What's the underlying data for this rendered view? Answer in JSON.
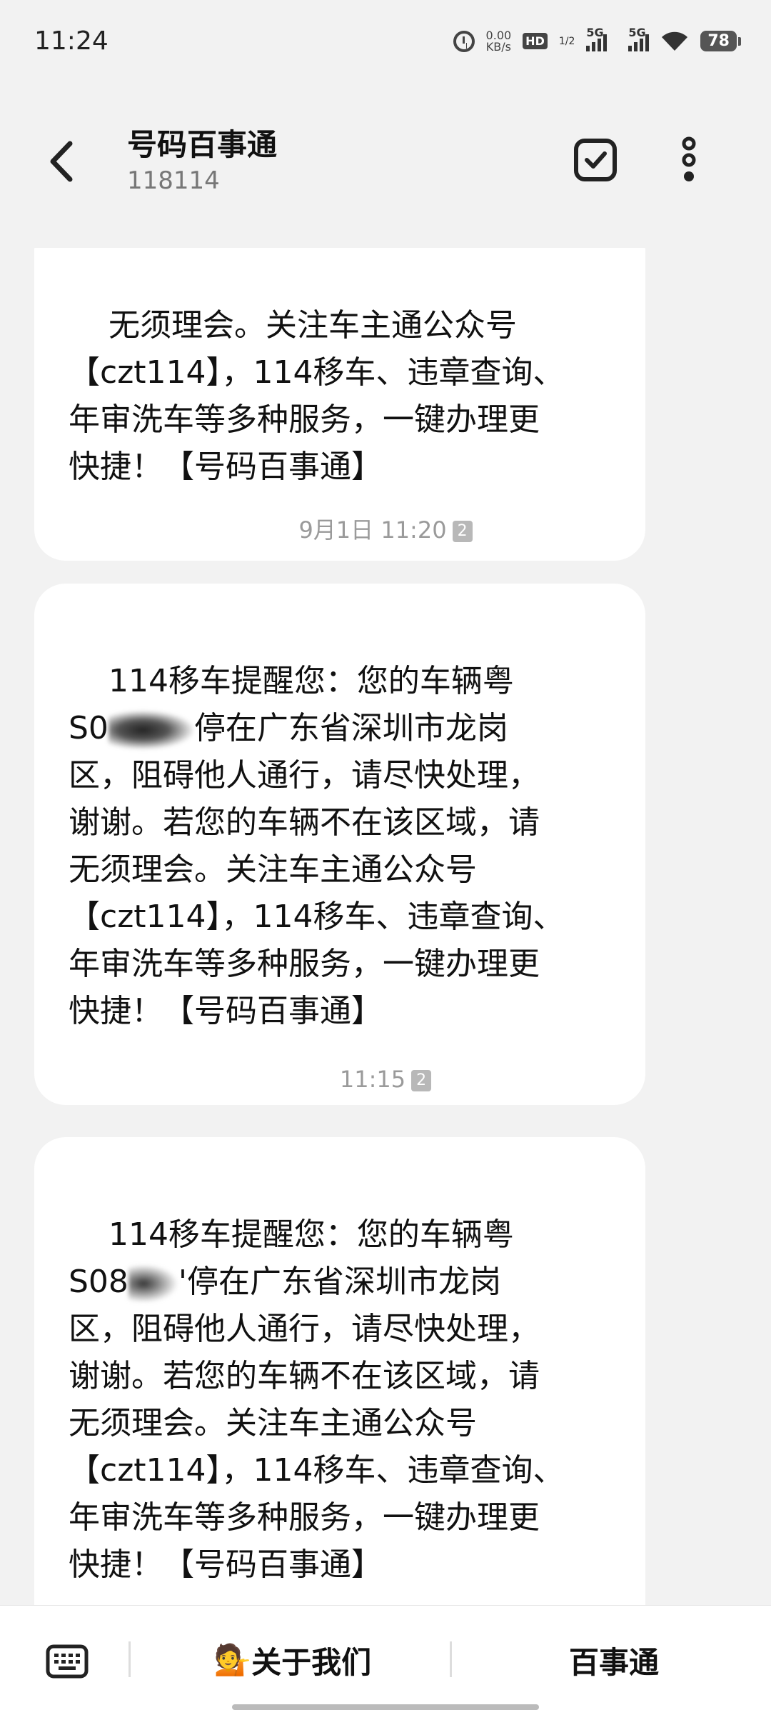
{
  "status": {
    "time": "11:24",
    "speed_value": "0.00",
    "speed_unit": "KB/s",
    "hd_label": "HD",
    "hd_sub": "1/2",
    "net1": "5G",
    "net2": "5G",
    "battery": "78"
  },
  "header": {
    "title": "号码百事通",
    "number": "118114"
  },
  "messages": [
    {
      "text_pre": "无须理会。关注车主通公众号\n【czt114】，114移车、违章查询、\n年审洗车等多种服务，一键办理更\n快捷！【号码百事通】"
    },
    {
      "timestamp": "9月1日 11:20",
      "sim": "2",
      "line1": "114移车提醒您：您的车辆粤",
      "plate_prefix": "S0",
      "after_plate": "停在广东省深圳市龙岗",
      "rest": "区，阻碍他人通行，请尽快处理，\n谢谢。若您的车辆不在该区域，请\n无须理会。关注车主通公众号\n【czt114】，114移车、违章查询、\n年审洗车等多种服务，一键办理更\n快捷！【号码百事通】"
    },
    {
      "timestamp": "11:15",
      "sim": "2",
      "line1": "114移车提醒您：您的车辆粤",
      "plate_prefix": "S08",
      "after_plate": "'停在广东省深圳市龙岗",
      "rest": "区，阻碍他人通行，请尽快处理，\n谢谢。若您的车辆不在该区域，请\n无须理会。关注车主通公众号\n【czt114】，114移车、违章查询、\n年审洗车等多种服务，一键办理更\n快捷！【号码百事通】"
    }
  ],
  "bottom": {
    "about_emoji": "💁",
    "about_label": "关于我们",
    "service_label": "百事通"
  }
}
